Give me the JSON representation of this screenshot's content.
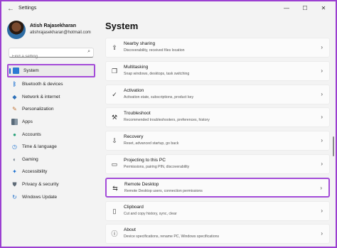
{
  "window": {
    "title": "Settings",
    "back_icon": "back-arrow-icon",
    "minimize": "—",
    "maximize": "☐",
    "close": "✕"
  },
  "profile": {
    "name": "Atish Rajasekharan",
    "email": "atishrajasekharan@hotmail.com"
  },
  "search": {
    "placeholder": "Find a setting"
  },
  "nav": {
    "items": [
      {
        "label": "System",
        "icon": "system-icon",
        "active": true
      },
      {
        "label": "Bluetooth & devices",
        "icon": "bluetooth-icon"
      },
      {
        "label": "Network & internet",
        "icon": "network-icon"
      },
      {
        "label": "Personalization",
        "icon": "personalization-icon"
      },
      {
        "label": "Apps",
        "icon": "apps-icon"
      },
      {
        "label": "Accounts",
        "icon": "accounts-icon"
      },
      {
        "label": "Time & language",
        "icon": "time-language-icon"
      },
      {
        "label": "Gaming",
        "icon": "gaming-icon"
      },
      {
        "label": "Accessibility",
        "icon": "accessibility-icon"
      },
      {
        "label": "Privacy & security",
        "icon": "privacy-icon"
      },
      {
        "label": "Windows Update",
        "icon": "windows-update-icon"
      }
    ]
  },
  "main": {
    "title": "System",
    "cards": [
      {
        "title": "Nearby sharing",
        "subtitle": "Discoverability, received files location",
        "icon": "share-icon"
      },
      {
        "title": "Multitasking",
        "subtitle": "Snap windows, desktops, task switching",
        "icon": "multitasking-icon"
      },
      {
        "title": "Activation",
        "subtitle": "Activation state, subscriptions, product key",
        "icon": "activation-icon"
      },
      {
        "title": "Troubleshoot",
        "subtitle": "Recommended troubleshooters, preferences, history",
        "icon": "wrench-icon"
      },
      {
        "title": "Recovery",
        "subtitle": "Reset, advanced startup, go back",
        "icon": "recovery-icon"
      },
      {
        "title": "Projecting to this PC",
        "subtitle": "Permissions, pairing PIN, discoverability",
        "icon": "projecting-icon"
      },
      {
        "title": "Remote Desktop",
        "subtitle": "Remote Desktop users, connection permissions",
        "icon": "remote-desktop-icon",
        "highlighted": true
      },
      {
        "title": "Clipboard",
        "subtitle": "Cut and copy history, sync, clear",
        "icon": "clipboard-icon"
      },
      {
        "title": "About",
        "subtitle": "Device specifications, rename PC, Windows specifications",
        "icon": "info-icon"
      }
    ]
  },
  "colors": {
    "highlight": "#a34bd8",
    "accent": "#1f6fc9",
    "background": "#f3f3f3"
  }
}
